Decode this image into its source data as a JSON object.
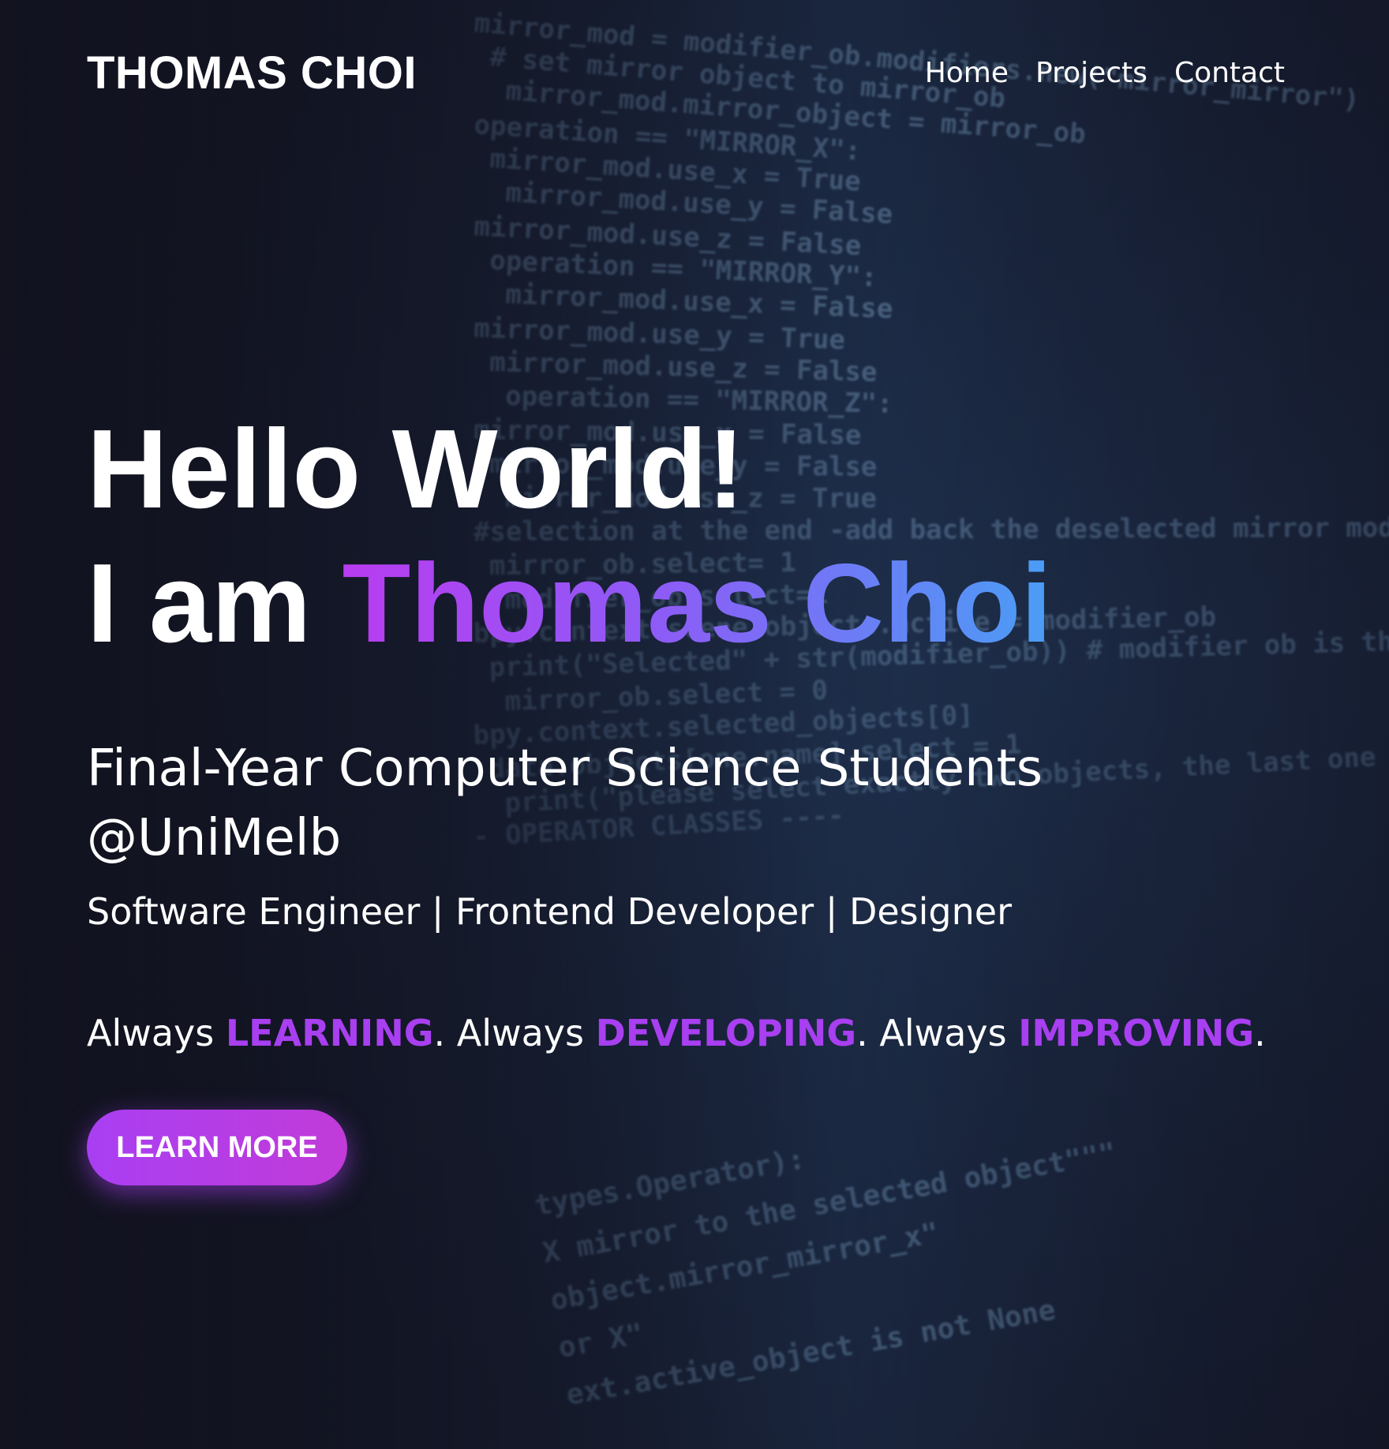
{
  "header": {
    "brand": "THOMAS CHOI",
    "nav": [
      {
        "label": "Home"
      },
      {
        "label": "Projects"
      },
      {
        "label": "Contact"
      }
    ]
  },
  "hero": {
    "line1": "Hello World!",
    "line2_prefix": "I am ",
    "name": "Thomas Choi",
    "subtitle": "Final-Year Computer Science Students @UniMelb",
    "roles": "Software Engineer | Frontend Developer | Designer",
    "motto": {
      "w1": "Always ",
      "h1": "LEARNING",
      "w2": ". Always ",
      "h2": "DEVELOPING",
      "w3": ". Always ",
      "h3": "IMPROVING",
      "end": "."
    },
    "cta_label": "LEARN MORE"
  },
  "background_code": [
    "mirror_mod = modifier_ob.modifiers.new(\"mirror_mirror\")",
    "# set mirror object to mirror_ob",
    "mirror_mod.mirror_object = mirror_ob",
    "operation == \"MIRROR_X\":",
    "mirror_mod.use_x = True",
    "mirror_mod.use_y = False",
    "mirror_mod.use_z = False",
    "operation == \"MIRROR_Y\":",
    "mirror_mod.use_x = False",
    "mirror_mod.use_y = True",
    "mirror_mod.use_z = False",
    "operation == \"MIRROR_Z\":",
    "mirror_mod.use_x = False",
    "mirror_mod.use_y = False",
    "mirror_mod.use_z = True",
    "#selection at the end -add back the deselected mirror modifier object",
    "mirror_ob.select= 1",
    "modifier_ob.select=1",
    "bpy.context.scene.objects.active = modifier_ob",
    "print(\"Selected\" + str(modifier_ob)) # modifier ob is the active ob",
    "mirror_ob.select = 0",
    "bpy.context.selected_objects[0]",
    "data.objects[one.name].select = 1",
    "print(\"please select exactly two objects, the last one gets the modifier unless its not a mesh\")",
    "- OPERATOR CLASSES ----",
    "types.Operator):",
    "X mirror to the selected object\"\"\"",
    "object.mirror_mirror_x\"",
    "or X\"",
    "ext.active_object is not None"
  ],
  "colors": {
    "background": "#121320",
    "accent": "#a83ff0",
    "gradient_start": "#b93cf0",
    "gradient_end": "#4a9ef5",
    "code": "#7fa6c9"
  }
}
